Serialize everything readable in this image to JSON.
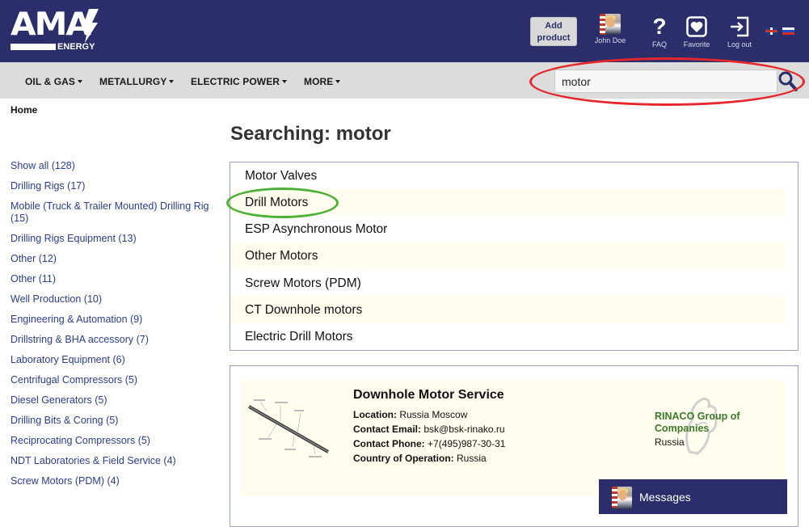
{
  "header": {
    "logo_main": "AMA",
    "logo_sub": "ENERGY",
    "add_product_label": "Add product",
    "user_name": "John Doe",
    "icons": [
      {
        "name": "faq-icon",
        "label": "FAQ"
      },
      {
        "name": "heart-icon",
        "label": "Favorite"
      },
      {
        "name": "logout-icon",
        "label": "Log out"
      }
    ],
    "languages": [
      "en",
      "ru"
    ]
  },
  "nav": {
    "items": [
      "OIL & GAS",
      "METALLURGY",
      "ELECTRIC POWER",
      "MORE"
    ],
    "search_value": "motor"
  },
  "breadcrumb": "Home",
  "page_title": "Searching: motor",
  "sidebar": {
    "items": [
      "Show all (128)",
      "Drilling Rigs (17)",
      "Mobile (Truck & Trailer Mounted) Drilling Rig (15)",
      "Drilling Rigs Equipment (13)",
      "Other (12)",
      "Other (11)",
      "Well Production (10)",
      "Engineering & Automation (9)",
      "Drillstring & BHA accessory (7)",
      "Laboratory Equipment (6)",
      "Centrifugal Compressors (5)",
      "Diesel Generators (5)",
      "Drilling Bits & Coring (5)",
      "Reciprocating Compressors (5)",
      "NDT Laboratories & Field Service (4)",
      "Screw Motors (PDM) (4)"
    ]
  },
  "categories": [
    "Motor Valves",
    "Drill Motors",
    "ESP Asynchronous Motor",
    "Other Motors",
    "Screw Motors (PDM)",
    "CT Downhole motors",
    "Electric Drill Motors"
  ],
  "card": {
    "title": "Downhole Motor Service",
    "location_label": "Location:",
    "location": "Russia Moscow",
    "email_label": "Contact Email:",
    "email": "bsk@bsk-rinako.ru",
    "phone_label": "Contact Phone:",
    "phone": "+7(495)987-30-31",
    "country_label": "Country of Operation:",
    "country": "Russia",
    "company_name": "RINACO Group of Companies",
    "company_country": "Russia"
  },
  "messages_label": "Messages",
  "colors": {
    "header_bg": "#2b2e6b",
    "nav_bg": "#dcdcdc",
    "link": "#2b3d8f",
    "row_alt": "#fffdee",
    "annotation_red": "#e6262b",
    "annotation_green": "#4caf36",
    "company_green": "#3c7a2a"
  }
}
